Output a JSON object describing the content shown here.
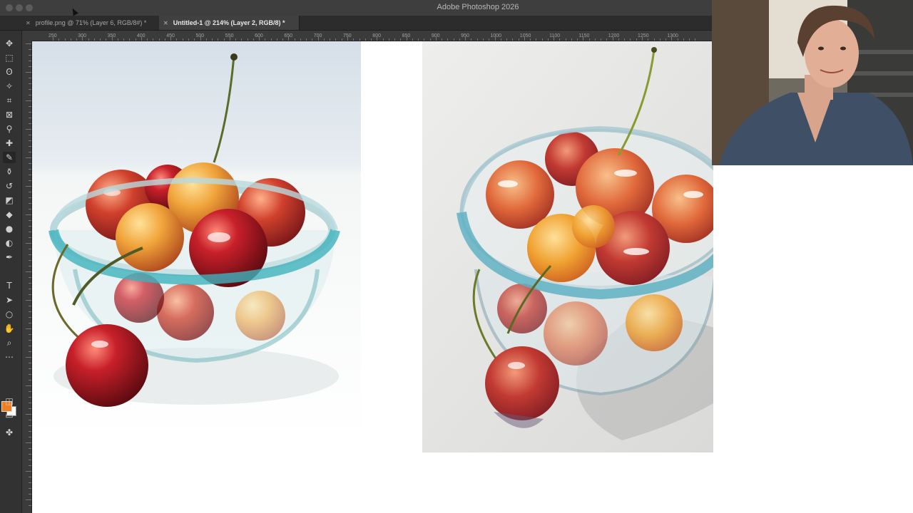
{
  "app": {
    "title": "Adobe Photoshop 2026"
  },
  "tabs": [
    {
      "label": "profile.png @ 71% (Layer 6, RGB/8#) *",
      "active": false
    },
    {
      "label": "Untitled-1 @ 214% (Layer 2, RGB/8) *",
      "active": true
    }
  ],
  "ruler": {
    "h_labels": [
      "250",
      "300",
      "350",
      "400",
      "450",
      "500",
      "550",
      "600",
      "650",
      "700",
      "750",
      "800",
      "850",
      "900",
      "950",
      "1000",
      "1050",
      "1100",
      "1150",
      "1200",
      "1250",
      "1300"
    ]
  },
  "toolbar": {
    "tools": [
      {
        "name": "move-tool",
        "glyph": "✥"
      },
      {
        "name": "marquee-tool",
        "glyph": "⬚"
      },
      {
        "name": "lasso-tool",
        "glyph": "ʘ"
      },
      {
        "name": "magic-wand-tool",
        "glyph": "✧"
      },
      {
        "name": "crop-tool",
        "glyph": "⌗"
      },
      {
        "name": "frame-tool",
        "glyph": "⊠"
      },
      {
        "name": "eyedropper-tool",
        "glyph": "⚲"
      },
      {
        "name": "healing-brush-tool",
        "glyph": "✚"
      },
      {
        "name": "brush-tool",
        "glyph": "✎",
        "active": true
      },
      {
        "name": "clone-stamp-tool",
        "glyph": "⚱"
      },
      {
        "name": "history-brush-tool",
        "glyph": "↺"
      },
      {
        "name": "eraser-tool",
        "glyph": "◩"
      },
      {
        "name": "paint-bucket-tool",
        "glyph": "◆"
      },
      {
        "name": "blur-tool",
        "glyph": "●"
      },
      {
        "name": "dodge-tool",
        "glyph": "◐"
      },
      {
        "name": "pen-tool",
        "glyph": "✒"
      },
      {
        "name": "type-tool",
        "glyph": "T"
      },
      {
        "name": "path-selection-tool",
        "glyph": "➤"
      },
      {
        "name": "shape-tool",
        "glyph": "○"
      },
      {
        "name": "hand-tool",
        "glyph": "✋"
      },
      {
        "name": "zoom-tool",
        "glyph": "⌕"
      },
      {
        "name": "more-tools",
        "glyph": "⋯"
      },
      {
        "name": "quick-mask-tool",
        "glyph": "◫"
      },
      {
        "name": "screen-mode-tool",
        "glyph": "▭"
      },
      {
        "name": "generative-tool",
        "glyph": "✤"
      }
    ],
    "foreground_color": "#f07f1e",
    "background_color": "#ffffff"
  }
}
